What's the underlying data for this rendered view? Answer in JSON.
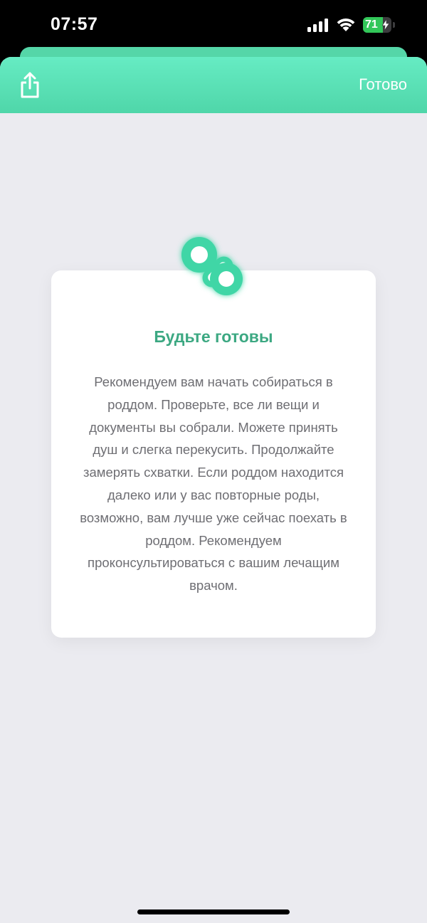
{
  "status_bar": {
    "time": "07:57",
    "battery_percent": 71,
    "battery_label": "71"
  },
  "header": {
    "done_label": "Готово",
    "share_icon": "share-icon"
  },
  "card": {
    "icon": "pacifier-icon",
    "title": "Будьте готовы",
    "body": "Рекомендуем вам начать собираться в роддом. Проверьте, все ли вещи и документы вы собрали. Можете принять душ и слегка перекусить. Продолжайте замерять схватки. Если роддом находится далеко или у вас повторные роды, возможно, вам лучше уже сейчас поехать в роддом. Рекомендуем проконсультироваться с вашим лечащим врачом."
  },
  "colors": {
    "accent": "#4fd6a9",
    "title": "#3ca882",
    "background": "#ebebf0"
  }
}
